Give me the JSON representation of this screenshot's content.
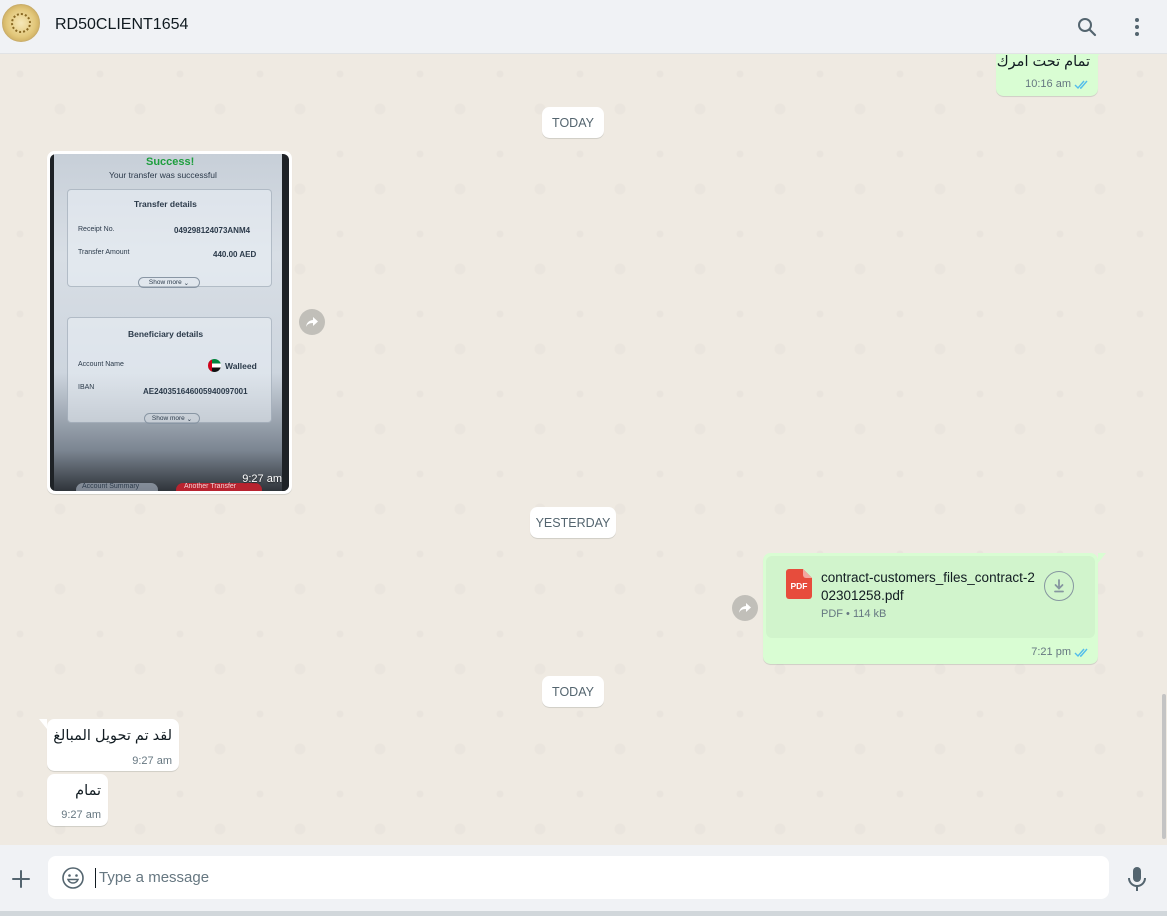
{
  "header": {
    "contact_name": "RD50CLIENT1654"
  },
  "chat": {
    "msg_top": {
      "text": "تمام تحت امرك",
      "time": "10:16 am"
    },
    "date_1": "TODAY",
    "image_msg": {
      "time": "9:27 am",
      "success": "Success!",
      "subtitle": "Your transfer was successful",
      "transfer_title": "Transfer details",
      "receipt_label": "Receipt No.",
      "receipt_value": "049298124073ANM4",
      "amount_label": "Transfer Amount",
      "amount_value": "440.00 AED",
      "show_more": "Show more",
      "beneficiary_title": "Beneficiary details",
      "account_label": "Account Name",
      "account_value": "Walleed",
      "iban_label": "IBAN",
      "iban_value": "AE240351646005940097001",
      "bottom_left": "Account Summary",
      "bottom_right": "Another Transfer"
    },
    "date_2": "YESTERDAY",
    "doc_msg": {
      "icon_label": "PDF",
      "filename": "contract-customers_files_contract-202301258.pdf",
      "type": "PDF",
      "size": "114 kB",
      "time": "7:21 pm"
    },
    "date_3": "TODAY",
    "msg_in_1": {
      "text": "لقد تم تحويل المبالغ",
      "time": "9:27 am"
    },
    "msg_in_2": {
      "text": "تمام",
      "time": "9:27 am"
    }
  },
  "footer": {
    "placeholder": "Type a message"
  },
  "colors": {
    "outgoing": "#d9fdd3",
    "incoming": "#ffffff",
    "read_tick": "#53bdeb",
    "pdf_red": "#e74c3c"
  }
}
